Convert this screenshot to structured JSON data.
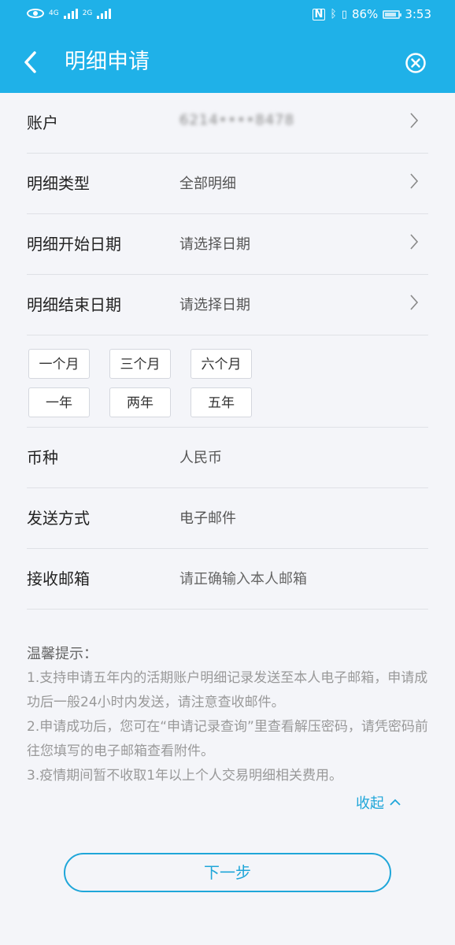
{
  "status_bar": {
    "net_type_1": "4G",
    "net_type_2": "2G",
    "battery_text": "86%",
    "battery_level": 0.86,
    "time": "3:53"
  },
  "header": {
    "title": "明细申请"
  },
  "form": {
    "account": {
      "label": "账户",
      "value": "6214••••8478"
    },
    "detail_type": {
      "label": "明细类型",
      "value": "全部明细"
    },
    "start_date": {
      "label": "明细开始日期",
      "placeholder": "请选择日期"
    },
    "end_date": {
      "label": "明细结束日期",
      "placeholder": "请选择日期"
    },
    "periods": [
      "一个月",
      "三个月",
      "六个月",
      "一年",
      "两年",
      "五年"
    ],
    "currency": {
      "label": "币种",
      "value": "人民币"
    },
    "send_method": {
      "label": "发送方式",
      "value": "电子邮件"
    },
    "email": {
      "label": "接收邮箱",
      "placeholder": "请正确输入本人邮箱"
    }
  },
  "tips": {
    "title": "温馨提示：",
    "items": [
      "1.支持申请五年内的活期账户明细记录发送至本人电子邮箱，申请成功后一般24小时内发送，请注意查收邮件。",
      "2.申请成功后，您可在“申请记录查询”里查看解压密码，请凭密码前往您填写的电子邮箱查看附件。",
      "3.疫情期间暂不收取1年以上个人交易明细相关费用。"
    ],
    "collapse_label": "收起"
  },
  "footer": {
    "next_label": "下一步"
  },
  "colors": {
    "brand": "#1fb1e8",
    "accent": "#1fa6d9",
    "background": "#f4f5f9"
  }
}
